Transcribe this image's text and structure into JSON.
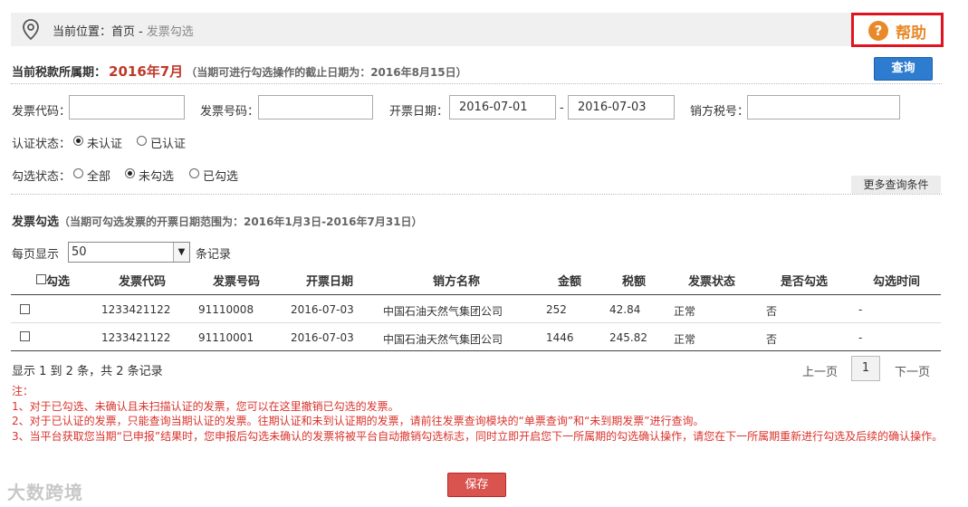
{
  "breadcrumb": {
    "prefix": "当前位置：",
    "home": "首页",
    "separator": "-",
    "current": "发票勾选"
  },
  "help": {
    "icon": "?",
    "label": "帮助"
  },
  "period": {
    "label": "当前税款所属期：",
    "month": "2016年7月",
    "note": "（当期可进行勾选操作的截止日期为：2016年8月15日）"
  },
  "query_button": "查询",
  "filters": {
    "invoice_code_label": "发票代码：",
    "invoice_code_value": "",
    "invoice_number_label": "发票号码：",
    "invoice_number_value": "",
    "date_label": "开票日期：",
    "date_from": "2016-07-01",
    "date_sep": "-",
    "date_to": "2016-07-03",
    "seller_tax_label": "销方税号：",
    "seller_tax_value": "",
    "cert_status_label": "认证状态：",
    "cert_options": [
      "未认证",
      "已认证"
    ],
    "cert_selected": "未认证",
    "check_status_label": "勾选状态：",
    "check_options": [
      "全部",
      "未勾选",
      "已勾选"
    ],
    "check_selected": "未勾选",
    "more_button": "更多查询条件"
  },
  "section": {
    "title": "发票勾选",
    "note": "（当期可勾选发票的开票日期范围为：2016年1月3日-2016年7月31日）"
  },
  "page_size": {
    "prefix": "每页显示",
    "value": "50",
    "suffix": "条记录"
  },
  "table": {
    "headers": [
      "勾选",
      "发票代码",
      "发票号码",
      "开票日期",
      "销方名称",
      "金额",
      "税额",
      "发票状态",
      "是否勾选",
      "勾选时间"
    ],
    "rows": [
      {
        "checked": false,
        "code": "1233421122",
        "number": "91110008",
        "date": "2016-07-03",
        "seller": "中国石油天然气集团公司",
        "amount": "252",
        "tax": "42.84",
        "status": "正常",
        "is_checked": "否",
        "check_time": "-"
      },
      {
        "checked": false,
        "code": "1233421122",
        "number": "91110001",
        "date": "2016-07-03",
        "seller": "中国石油天然气集团公司",
        "amount": "1446",
        "tax": "245.82",
        "status": "正常",
        "is_checked": "否",
        "check_time": "-"
      }
    ]
  },
  "pagination": {
    "summary": "显示 1 到 2 条，共 2 条记录",
    "prev": "上一页",
    "page": "1",
    "next": "下一页"
  },
  "notes": {
    "title": "注：",
    "items": [
      "1、对于已勾选、未确认且未扫描认证的发票，您可以在这里撤销已勾选的发票。",
      "2、对于已认证的发票，只能查询当期认证的发票。往期认证和未到认证期的发票，请前往发票查询模块的“单票查询”和“未到期发票”进行查询。",
      "3、当平台获取您当期“已申报”结果时，您申报后勾选未确认的发票将被平台自动撤销勾选标志，同时立即开启您下一所属期的勾选确认操作，请您在下一所属期重新进行勾选及后续的确认操作。"
    ]
  },
  "save_button": "保存",
  "watermark": "大数跨境",
  "colors": {
    "accent_blue": "#2e7cd0",
    "alert_red": "#d9322b",
    "help_orange": "#e8892a",
    "save_red": "#d9534f"
  }
}
